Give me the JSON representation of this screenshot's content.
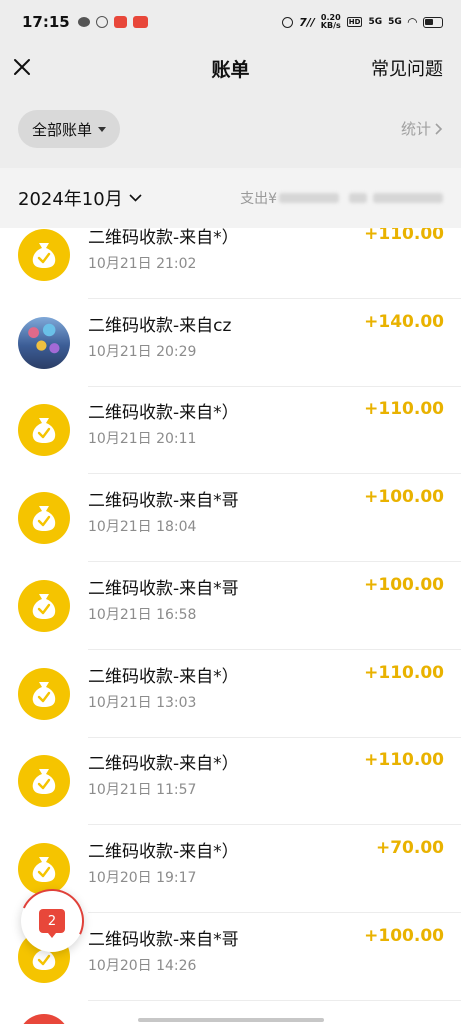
{
  "status_bar": {
    "time": "17:15",
    "network_speed_top": "0.20",
    "network_speed_bottom": "KB/s",
    "signal_1": "5G",
    "signal_2": "5G",
    "hd_label": "HD"
  },
  "nav": {
    "title": "账单",
    "faq_label": "常见问题",
    "close_icon": "close-icon"
  },
  "filter": {
    "all_bills_label": "全部账单",
    "stats_label": "统计"
  },
  "month": {
    "label": "2024年10月",
    "summary_prefix": "支出¥"
  },
  "transactions": [
    {
      "title": "二维码收款-来自*）",
      "time": "10月21日 21:02",
      "amount": "+110.00",
      "icon": "money-bag-icon"
    },
    {
      "title": "二维码收款-来自cz",
      "time": "10月21日 20:29",
      "amount": "+140.00",
      "icon": "avatar-photo"
    },
    {
      "title": "二维码收款-来自*）",
      "time": "10月21日 20:11",
      "amount": "+110.00",
      "icon": "money-bag-icon"
    },
    {
      "title": "二维码收款-来自*哥",
      "time": "10月21日 18:04",
      "amount": "+100.00",
      "icon": "money-bag-icon"
    },
    {
      "title": "二维码收款-来自*哥",
      "time": "10月21日 16:58",
      "amount": "+100.00",
      "icon": "money-bag-icon"
    },
    {
      "title": "二维码收款-来自*）",
      "time": "10月21日 13:03",
      "amount": "+110.00",
      "icon": "money-bag-icon"
    },
    {
      "title": "二维码收款-来自*）",
      "time": "10月21日 11:57",
      "amount": "+110.00",
      "icon": "money-bag-icon"
    },
    {
      "title": "二维码收款-来自*）",
      "time": "10月20日 19:17",
      "amount": "+70.00",
      "icon": "money-bag-icon"
    },
    {
      "title": "二维码收款-来自*哥",
      "time": "10月20日 14:26",
      "amount": "+100.00",
      "icon": "money-bag-icon"
    }
  ],
  "float_badge": {
    "count": "2"
  },
  "colors": {
    "accent_yellow": "#f5c400",
    "amount_color": "#e9b200",
    "badge_red": "#e8473a"
  }
}
